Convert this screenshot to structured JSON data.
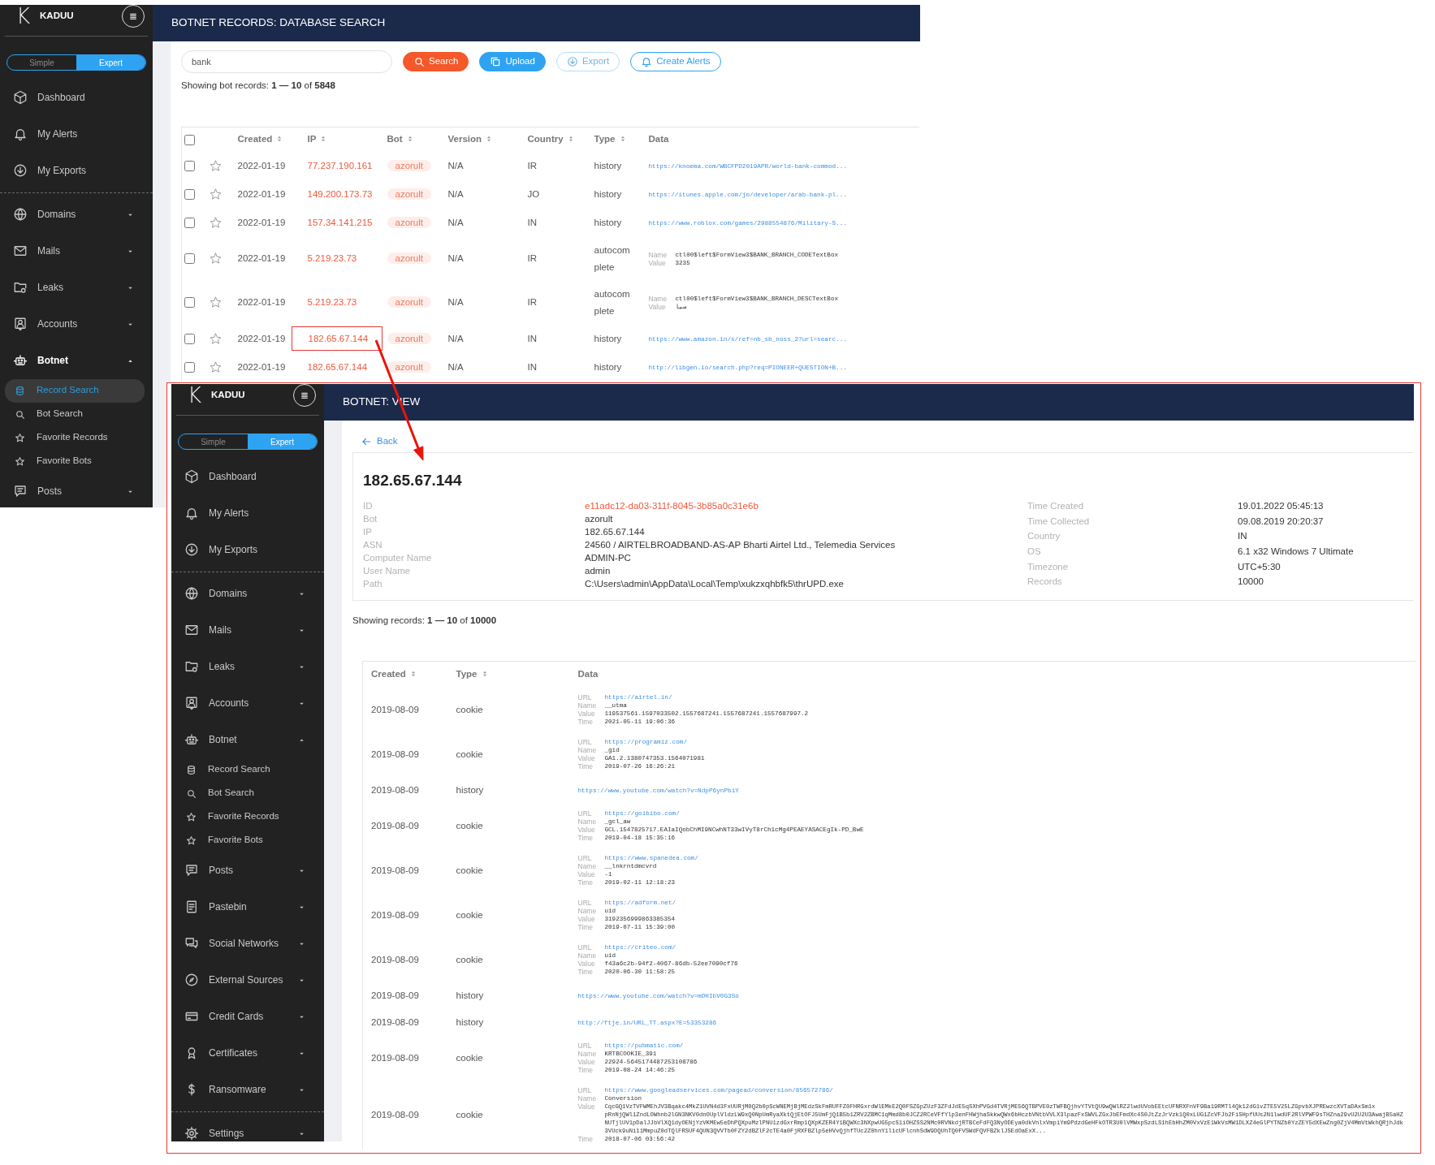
{
  "search_screen": {
    "sidebar": {
      "logo_letter": "K",
      "brand": "KADUU",
      "modes": [
        {
          "label": "Simple",
          "selected": false
        },
        {
          "label": "Expert",
          "selected": true
        }
      ],
      "items": [
        {
          "kind": "link",
          "label": "Dashboard",
          "active": false
        },
        {
          "kind": "link",
          "label": "My Alerts",
          "active": false
        },
        {
          "kind": "link",
          "label": "My Exports",
          "active": false
        },
        {
          "kind": "divider"
        },
        {
          "kind": "group",
          "label": "Domains",
          "active": false,
          "expanded": false
        },
        {
          "kind": "group",
          "label": "Mails",
          "active": false,
          "expanded": false
        },
        {
          "kind": "group",
          "label": "Leaks",
          "active": false,
          "expanded": false
        },
        {
          "kind": "group",
          "label": "Accounts",
          "active": false,
          "expanded": false
        },
        {
          "kind": "group",
          "label": "Botnet",
          "active": true,
          "expanded": true,
          "children": [
            {
              "label": "Record Search",
              "selected": true
            },
            {
              "label": "Bot Search",
              "selected": false
            },
            {
              "label": "Favorite Records",
              "selected": false
            },
            {
              "label": "Favorite Bots",
              "selected": false
            }
          ]
        },
        {
          "kind": "group",
          "label": "Posts",
          "active": false,
          "expanded": false
        }
      ]
    },
    "header_title": "BOTNET RECORDS: DATABASE SEARCH",
    "search": {
      "value": "bank"
    },
    "buttons": [
      {
        "label": "Search",
        "kind": "filled",
        "color": "#f5582a",
        "disabled": false
      },
      {
        "label": "Upload",
        "kind": "filled",
        "color": "#2ea3f2",
        "disabled": false
      },
      {
        "label": "Export",
        "kind": "outline",
        "color": "#b3dcf8",
        "disabled": true
      },
      {
        "label": "Create Alerts",
        "kind": "outline",
        "color": "#2ea3f2",
        "disabled": false
      }
    ],
    "summary": "Showing bot records: **1 — 10** of **5848**",
    "table": {
      "all_selected": false,
      "columns": [
        {
          "label": "Created",
          "sortable": true
        },
        {
          "label": "IP",
          "sortable": true
        },
        {
          "label": "Bot",
          "sortable": true
        },
        {
          "label": "Version",
          "sortable": true
        },
        {
          "label": "Country",
          "sortable": true
        },
        {
          "label": "Type",
          "sortable": true
        },
        {
          "label": "Data"
        }
      ],
      "rows": [
        {
          "checked": false,
          "starred": false,
          "highlighted": false,
          "created": "2022-01-19",
          "ip": "77.237.190.161",
          "bot": "azorult",
          "version": "N/A",
          "country": "IR",
          "type": "history",
          "data": {
            "kind": "url",
            "url": "https://knoema.com/WBCFPD2019APR/world-bank-commod..."
          }
        },
        {
          "checked": false,
          "starred": false,
          "highlighted": false,
          "created": "2022-01-19",
          "ip": "149.200.173.73",
          "bot": "azorult",
          "version": "N/A",
          "country": "JO",
          "type": "history",
          "data": {
            "kind": "url",
            "url": "https://itunes.apple.com/jo/developer/arab-bank-pl..."
          }
        },
        {
          "checked": false,
          "starred": false,
          "highlighted": false,
          "created": "2022-01-19",
          "ip": "157.34.141.215",
          "bot": "azorult",
          "version": "N/A",
          "country": "IN",
          "type": "history",
          "data": {
            "kind": "url",
            "url": "https://www.roblox.com/games/2988554876/Military-S..."
          }
        },
        {
          "checked": false,
          "starred": false,
          "highlighted": false,
          "created": "2022-01-19",
          "ip": "5.219.23.73",
          "bot": "azorult",
          "version": "N/A",
          "country": "IR",
          "type": "autocomplete",
          "data": {
            "kind": "fields",
            "fields": [
              {
                "label": "Name",
                "kind": "text",
                "value": "ctl00$left$FormView3$BANK_BRANCH_CODETextBox"
              },
              {
                "label": "Value",
                "kind": "text",
                "value": "3235"
              }
            ]
          }
        },
        {
          "checked": false,
          "starred": false,
          "highlighted": false,
          "created": "2022-01-19",
          "ip": "5.219.23.73",
          "bot": "azorult",
          "version": "N/A",
          "country": "IR",
          "type": "autocomplete",
          "data": {
            "kind": "fields",
            "fields": [
              {
                "label": "Name",
                "kind": "text",
                "value": "ctl00$left$FormView3$BANK_BRANCH_DESCTextBox"
              },
              {
                "label": "Value",
                "kind": "text",
                "value": "سيا"
              }
            ]
          }
        },
        {
          "checked": false,
          "starred": false,
          "highlighted": true,
          "created": "2022-01-19",
          "ip": "182.65.67.144",
          "bot": "azorult",
          "version": "N/A",
          "country": "IN",
          "type": "history",
          "data": {
            "kind": "url",
            "url": "https://www.amazon.in/s/ref=nb_sb_noss_2?url=searc..."
          }
        },
        {
          "checked": false,
          "starred": false,
          "highlighted": false,
          "created": "2022-01-19",
          "ip": "182.65.67.144",
          "bot": "azorult",
          "version": "N/A",
          "country": "IN",
          "type": "history",
          "data": {
            "kind": "url",
            "url": "http://libgen.io/search.php?req=PIONEER+QUESTION+B..."
          }
        }
      ]
    }
  },
  "view_screen": {
    "sidebar": {
      "logo_letter": "K",
      "brand": "KADUU",
      "modes": [
        {
          "label": "Simple",
          "selected": false
        },
        {
          "label": "Expert",
          "selected": true
        }
      ],
      "items": [
        {
          "kind": "link",
          "label": "Dashboard",
          "active": false
        },
        {
          "kind": "link",
          "label": "My Alerts",
          "active": false
        },
        {
          "kind": "link",
          "label": "My Exports",
          "active": false
        },
        {
          "kind": "divider"
        },
        {
          "kind": "group",
          "label": "Domains",
          "active": false,
          "expanded": false
        },
        {
          "kind": "group",
          "label": "Mails",
          "active": false,
          "expanded": false
        },
        {
          "kind": "group",
          "label": "Leaks",
          "active": false,
          "expanded": false
        },
        {
          "kind": "group",
          "label": "Accounts",
          "active": false,
          "expanded": false
        },
        {
          "kind": "group",
          "label": "Botnet",
          "active": false,
          "expanded": true,
          "children": [
            {
              "label": "Record Search",
              "selected": false
            },
            {
              "label": "Bot Search",
              "selected": false
            },
            {
              "label": "Favorite Records",
              "selected": false
            },
            {
              "label": "Favorite Bots",
              "selected": false
            }
          ]
        },
        {
          "kind": "group",
          "label": "Posts",
          "active": false,
          "expanded": false
        },
        {
          "kind": "group",
          "label": "Pastebin",
          "active": false,
          "expanded": false
        },
        {
          "kind": "group",
          "label": "Social Networks",
          "active": false,
          "expanded": false
        },
        {
          "kind": "group",
          "label": "External Sources",
          "active": false,
          "expanded": false
        },
        {
          "kind": "group",
          "label": "Credit Cards",
          "active": false,
          "expanded": false
        },
        {
          "kind": "group",
          "label": "Certificates",
          "active": false,
          "expanded": false
        },
        {
          "kind": "group",
          "label": "Ransomware",
          "active": false,
          "expanded": false
        },
        {
          "kind": "divider"
        },
        {
          "kind": "group",
          "label": "Settings",
          "active": false,
          "expanded": false
        }
      ]
    },
    "header_title": "BOTNET: VIEW",
    "back_link": "Back",
    "title": "182.65.67.144",
    "details_left": [
      {
        "label": "ID",
        "value": "e11adc12-da03-311f-8045-3b85a0c31e6b",
        "accent": true
      },
      {
        "label": "Bot",
        "value": "azorult",
        "accent": false
      },
      {
        "label": "IP",
        "value": "182.65.67.144",
        "accent": false
      },
      {
        "label": "ASN",
        "value": "24560 / AIRTELBROADBAND-AS-AP Bharti Airtel Ltd., Telemedia Services",
        "accent": false
      },
      {
        "label": "Computer Name",
        "value": "ADMIN-PC",
        "accent": false
      },
      {
        "label": "User Name",
        "value": "admin",
        "accent": false
      },
      {
        "label": "Path",
        "value": "C:\\Users\\admin\\AppData\\Local\\Temp\\xukzxqhbfk5\\thrUPD.exe",
        "accent": false
      }
    ],
    "details_right": [
      {
        "label": "Time Created",
        "value": "19.01.2022 05:45:13"
      },
      {
        "label": "Time Collected",
        "value": "09.08.2019 20:20:37"
      },
      {
        "label": "Country",
        "value": "IN"
      },
      {
        "label": "OS",
        "value": "6.1 x32 Windows 7 Ultimate"
      },
      {
        "label": "Timezone",
        "value": "UTC+5:30"
      },
      {
        "label": "Records",
        "value": "10000"
      }
    ],
    "summary": "Showing records: **1 — 10** of **10000**",
    "table": {
      "columns": [
        {
          "label": "Created",
          "sortable": true
        },
        {
          "label": "Type",
          "sortable": true
        },
        {
          "label": "Data"
        }
      ],
      "rows": [
        {
          "created": "2019-08-09",
          "type": "cookie",
          "data": {
            "kind": "fields",
            "fields": [
              {
                "label": "URL",
                "kind": "link",
                "value": "https://airtel.in/"
              },
              {
                "label": "Name",
                "kind": "text",
                "value": "__utma"
              },
              {
                "label": "Value",
                "kind": "text",
                "value": "119537561.1597033502.1557687241.1557687241.1557687997.2"
              },
              {
                "label": "Time",
                "kind": "text",
                "value": "2021-05-11 19:06:36"
              }
            ]
          }
        },
        {
          "created": "2019-08-09",
          "type": "cookie",
          "data": {
            "kind": "fields",
            "fields": [
              {
                "label": "URL",
                "kind": "link",
                "value": "https://programiz.com/"
              },
              {
                "label": "Name",
                "kind": "text",
                "value": "_gid"
              },
              {
                "label": "Value",
                "kind": "text",
                "value": "GA1.2.1380747353.1564071981"
              },
              {
                "label": "Time",
                "kind": "text",
                "value": "2019-07-26 16:26:21"
              }
            ]
          }
        },
        {
          "created": "2019-08-09",
          "type": "history",
          "data": {
            "kind": "url",
            "url": "https://www.youtube.com/watch?v=NdpP6ynPbiY"
          }
        },
        {
          "created": "2019-08-09",
          "type": "cookie",
          "data": {
            "kind": "fields",
            "fields": [
              {
                "label": "URL",
                "kind": "link",
                "value": "https://goibibo.com/"
              },
              {
                "label": "Name",
                "kind": "text",
                "value": "_gcl_aw"
              },
              {
                "label": "Value",
                "kind": "text",
                "value": "GCL.1547825717.EAIaIQobChMI9NCwhNT33wIVyT8rCh1cMg4PEAEYASACEgIk-PD_BwE"
              },
              {
                "label": "Time",
                "kind": "text",
                "value": "2019-04-18 15:35:16"
              }
            ]
          }
        },
        {
          "created": "2019-08-09",
          "type": "cookie",
          "data": {
            "kind": "fields",
            "fields": [
              {
                "label": "URL",
                "kind": "link",
                "value": "https://www.spanedea.com/"
              },
              {
                "label": "Name",
                "kind": "text",
                "value": "__lnkrntdmcvrd"
              },
              {
                "label": "Value",
                "kind": "text",
                "value": "-1"
              },
              {
                "label": "Time",
                "kind": "text",
                "value": "2019-02-11 12:18:23"
              }
            ]
          }
        },
        {
          "created": "2019-08-09",
          "type": "cookie",
          "data": {
            "kind": "fields",
            "fields": [
              {
                "label": "URL",
                "kind": "link",
                "value": "https://adform.net/"
              },
              {
                "label": "Name",
                "kind": "text",
                "value": "uid"
              },
              {
                "label": "Value",
                "kind": "text",
                "value": "3192356999863385354"
              },
              {
                "label": "Time",
                "kind": "text",
                "value": "2019-07-11 15:39:00"
              }
            ]
          }
        },
        {
          "created": "2019-08-09",
          "type": "cookie",
          "data": {
            "kind": "fields",
            "fields": [
              {
                "label": "URL",
                "kind": "link",
                "value": "https://criteo.com/"
              },
              {
                "label": "Name",
                "kind": "text",
                "value": "uid"
              },
              {
                "label": "Value",
                "kind": "text",
                "value": "f43a6c2b-94f2-4067-86db-52ee7090cf76"
              },
              {
                "label": "Time",
                "kind": "text",
                "value": "2020-06-30 11:58:25"
              }
            ]
          }
        },
        {
          "created": "2019-08-09",
          "type": "history",
          "data": {
            "kind": "url",
            "url": "https://www.youtube.com/watch?v=mDHIbV0G3So"
          }
        },
        {
          "created": "2019-08-09",
          "type": "history",
          "data": {
            "kind": "url",
            "url": "http://ftje.in/URL_TT.aspx?E=53353286"
          }
        },
        {
          "created": "2019-08-09",
          "type": "cookie",
          "data": {
            "kind": "fields",
            "fields": [
              {
                "label": "URL",
                "kind": "link",
                "value": "https://pubmatic.com/"
              },
              {
                "label": "Name",
                "kind": "text",
                "value": "KRTBCOOKIE_391"
              },
              {
                "label": "Value",
                "kind": "text",
                "value": "22924-5645174487253108786"
              },
              {
                "label": "Time",
                "kind": "text",
                "value": "2019-08-24 14:46:25"
              }
            ]
          }
        },
        {
          "created": "2019-08-09",
          "type": "cookie",
          "data": {
            "kind": "fields",
            "fields": [
              {
                "label": "URL",
                "kind": "link",
                "value": "https://www.googleadservices.com/pagead/conversion/856572786/"
              },
              {
                "label": "Name",
                "kind": "text",
                "value": "Conversion"
              },
              {
                "label": "Value",
                "kind": "lines",
                "lines": [
                  "CqcGQ1VzTVFWMEhJV3Bqakc4MkZ1UVN4d3FxUURjM0Q2b0pScWNEMjBjMEdzSkFmRUFFZ0FHRGxrdWlEMkE2Q0FSZGpZUzF3ZFdJdE5qSXhPVGd4TVRjME56QTBPVE0zTWFBQjhvYTVtQU9wQWlRZ2lwdUVobEEtcUFNRXFnVF9Ba19RMTl4Qk12dG1vZTE5V25LZGpvbXJPREwzcXVTaDAxSm1x",
                  "pRnNjQWl1ZndLOWhnb2lGN3NKV0dnOUplVldzLW9xQ0NpUmRyaXktQjEtOFJ5UmFjQ1B5b1ZRV2ZBMC1qMmd8b0JCZ2RCeVFfYlp3enFHWjhaSkkwQWx6bHczbVNtbVVLX3lpazFxSWVLZGxJbEFmdXc4S0JtZzJrVzk1Q0xLUG1ZcVFJb2FiSHpfUUs2N1lwdUF2RlVPWF9sTHZna29vU2U2U3AwajB5aHZ",
                  "NUTjlUV1pDalJJbVlXQ1dyOENjYzVKMEw5eDhPQXpuMzlPNU1zdGxrRmp1QXpKZER4Y1BQWXc3NXpwUG5pcS1iOHZSS2NMc0RVNkdjRTBCeFdFQ3NyODEya0dkVnlxVmpiYm9PdzdGeHFkOTR3U0lVMWxpSzdLS1hEbHhZM0VxVzE1WkVsMW1DLXZ4eGlPYTNZb0YzZEY5dXEwZng0ZjV4MmVtWkhQRjhJdk",
                  "3VUck9uNi11MmpuZ0dTQlFRSUF4QUN3QVVTb0FZY2dBZlF2cTE4a0FjRXFBZlp5eHVvQjhfTUc2Z0hnY1licUFlcnhSdW9DQUhTQ0FVSWdFQVFBZklJSEdOaExX..."
                ]
              },
              {
                "label": "Time",
                "kind": "text",
                "value": "2018-07-06 03:56:42"
              }
            ]
          }
        }
      ]
    }
  }
}
